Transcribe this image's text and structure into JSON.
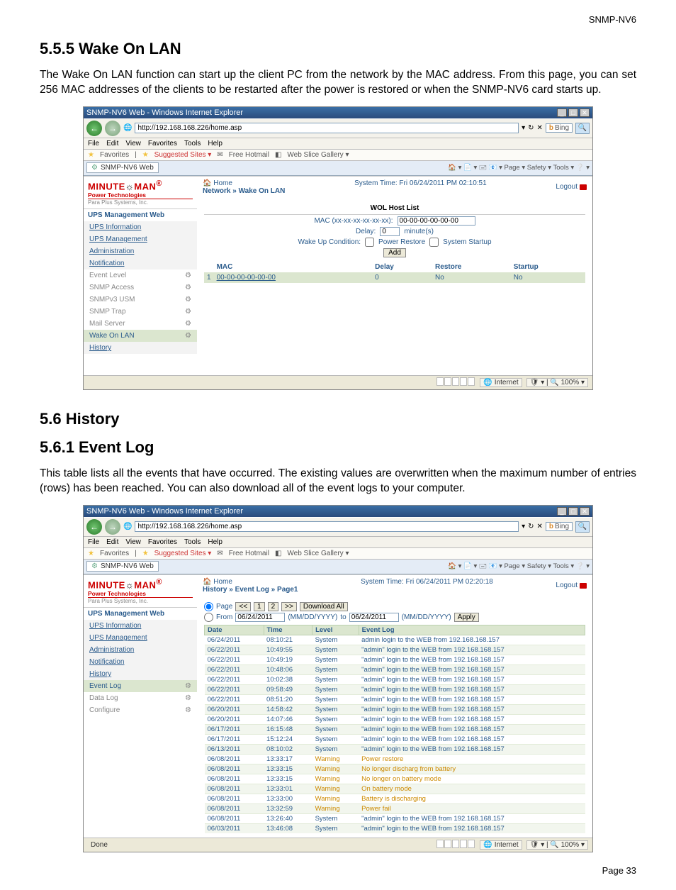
{
  "doc": {
    "top_right": "SNMP-NV6",
    "h_555": "5.5.5 Wake On LAN",
    "p_555": "The Wake On LAN function can start up the client PC from the network by the MAC address. From this page, you can set 256 MAC addresses of the clients to be restarted after the power is restored or when the SNMP-NV6 card starts up.",
    "h_56": "5.6 History",
    "h_561": "5.6.1 Event Log",
    "p_561": "This table lists all the events that have occurred. The existing values are overwritten when the maximum number of entries (rows) has been reached. You can also download all of the event logs to your computer.",
    "foot": "Page 33"
  },
  "ie": {
    "title": "SNMP-NV6 Web - Windows Internet Explorer",
    "url": "http://192.168.168.226/home.asp",
    "bing": "Bing",
    "menu": {
      "file": "File",
      "edit": "Edit",
      "view": "View",
      "favorites": "Favorites",
      "tools": "Tools",
      "help": "Help"
    },
    "fav": {
      "label": "Favorites",
      "suggested": "Suggested Sites ▾",
      "free": "Free Hotmail",
      "slice": "Web Slice Gallery ▾"
    },
    "tab": "SNMP-NV6 Web",
    "toolbar": "🏠 ▾  📄 ▾  🖃  📧 ▾  Page ▾  Safety ▾  Tools ▾  ❔ ▾",
    "status_internet": "Internet",
    "status_zoom": "100%"
  },
  "brand": {
    "mm1": "MINUTE",
    "mm2": "MAN",
    "pt": "Power Technologies",
    "pp": "Para Plus Systems, Inc."
  },
  "wol": {
    "system_time": "System Time: Fri 06/24/2011 PM 02:10:51",
    "logout": "Logout",
    "home": "Home",
    "breadcrumb": "Network » Wake On LAN",
    "header_ups": "UPS Management Web",
    "sidebar": {
      "items": [
        "UPS Information",
        "UPS Management",
        "Administration",
        "Notification"
      ],
      "sub": [
        {
          "label": "Event Level"
        },
        {
          "label": "SNMP Access"
        },
        {
          "label": "SNMPv3 USM"
        },
        {
          "label": "SNMP Trap"
        },
        {
          "label": "Mail Server"
        },
        {
          "label": "Wake On LAN"
        }
      ],
      "history": "History"
    },
    "hostlist": "WOL Host List",
    "mac_lbl": "MAC (xx-xx-xx-xx-xx-xx):",
    "mac_val": "00-00-00-00-00-00",
    "delay_lbl": "Delay:",
    "delay_val": "0",
    "delay_unit": "minute(s)",
    "cond_lbl": "Wake Up Condition:",
    "cond1": "Power Restore",
    "cond2": "System Startup",
    "add": "Add",
    "table": {
      "headers": [
        "MAC",
        "Delay",
        "Restore",
        "Startup"
      ],
      "rows": [
        {
          "n": "1",
          "mac": "00-00-00-00-00-00",
          "delay": "0",
          "restore": "No",
          "startup": "No"
        }
      ]
    }
  },
  "evt": {
    "system_time": "System Time: Fri 06/24/2011 PM 02:20:18",
    "logout": "Logout",
    "home": "Home",
    "breadcrumb": "History » Event Log » Page1",
    "header_ups": "UPS Management Web",
    "sidebar": {
      "items": [
        "UPS Information",
        "UPS Management",
        "Administration",
        "Notification",
        "History"
      ],
      "sub": [
        {
          "label": "Event Log"
        },
        {
          "label": "Data Log"
        },
        {
          "label": "Configure"
        }
      ]
    },
    "page_lbl": "Page",
    "p_prev": "<<",
    "p_1": "1",
    "p_2": "2",
    "p_next": ">>",
    "download": "Download All",
    "from_lbl": "From",
    "from_val": "06/24/2011",
    "to_lbl": "to",
    "to_val": "06/24/2011",
    "fmt": "(MM/DD/YYYY)",
    "apply": "Apply",
    "headers": [
      "Date",
      "Time",
      "Level",
      "Event Log"
    ],
    "rows": [
      {
        "d": "06/24/2011",
        "t": "08:10:21",
        "l": "System",
        "m": "admin login to the WEB from 192.168.168.157",
        "lw": false
      },
      {
        "d": "06/22/2011",
        "t": "10:49:55",
        "l": "System",
        "m": "\"admin\" login to the WEB from 192.168.168.157",
        "lw": false
      },
      {
        "d": "06/22/2011",
        "t": "10:49:19",
        "l": "System",
        "m": "\"admin\" login to the WEB from 192.168.168.157",
        "lw": false
      },
      {
        "d": "06/22/2011",
        "t": "10:48:06",
        "l": "System",
        "m": "\"admin\" login to the WEB from 192.168.168.157",
        "lw": false
      },
      {
        "d": "06/22/2011",
        "t": "10:02:38",
        "l": "System",
        "m": "\"admin\" login to the WEB from 192.168.168.157",
        "lw": false
      },
      {
        "d": "06/22/2011",
        "t": "09:58:49",
        "l": "System",
        "m": "\"admin\" login to the WEB from 192.168.168.157",
        "lw": false
      },
      {
        "d": "06/22/2011",
        "t": "08:51:20",
        "l": "System",
        "m": "\"admin\" login to the WEB from 192.168.168.157",
        "lw": false
      },
      {
        "d": "06/20/2011",
        "t": "14:58:42",
        "l": "System",
        "m": "\"admin\" login to the WEB from 192.168.168.157",
        "lw": false
      },
      {
        "d": "06/20/2011",
        "t": "14:07:46",
        "l": "System",
        "m": "\"admin\" login to the WEB from 192.168.168.157",
        "lw": false
      },
      {
        "d": "06/17/2011",
        "t": "16:15:48",
        "l": "System",
        "m": "\"admin\" login to the WEB from 192.168.168.157",
        "lw": false
      },
      {
        "d": "06/17/2011",
        "t": "15:12:24",
        "l": "System",
        "m": "\"admin\" login to the WEB from 192.168.168.157",
        "lw": false
      },
      {
        "d": "06/13/2011",
        "t": "08:10:02",
        "l": "System",
        "m": "\"admin\" login to the WEB from 192.168.168.157",
        "lw": false
      },
      {
        "d": "06/08/2011",
        "t": "13:33:17",
        "l": "Warning",
        "m": "Power restore",
        "lw": true
      },
      {
        "d": "06/08/2011",
        "t": "13:33:15",
        "l": "Warning",
        "m": "No longer discharg from battery",
        "lw": true
      },
      {
        "d": "06/08/2011",
        "t": "13:33:15",
        "l": "Warning",
        "m": "No longer on battery mode",
        "lw": true
      },
      {
        "d": "06/08/2011",
        "t": "13:33:01",
        "l": "Warning",
        "m": "On battery mode",
        "lw": true
      },
      {
        "d": "06/08/2011",
        "t": "13:33:00",
        "l": "Warning",
        "m": "Battery is discharging",
        "lw": true
      },
      {
        "d": "06/08/2011",
        "t": "13:32:59",
        "l": "Warning",
        "m": "Power fail",
        "lw": true
      },
      {
        "d": "06/08/2011",
        "t": "13:26:40",
        "l": "System",
        "m": "\"admin\" login to the WEB from 192.168.168.157",
        "lw": false
      },
      {
        "d": "06/03/2011",
        "t": "13:46:08",
        "l": "System",
        "m": "\"admin\" login to the WEB from 192.168.168.157",
        "lw": false
      }
    ],
    "done": "Done"
  }
}
